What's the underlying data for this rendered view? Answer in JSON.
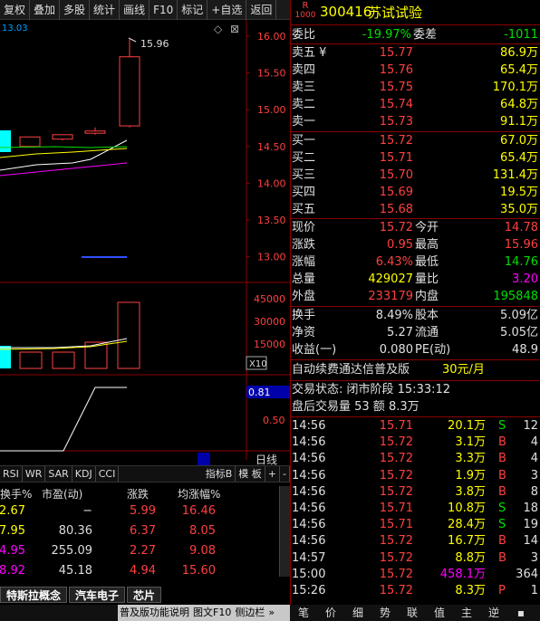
{
  "toolbar": {
    "items": [
      "复权",
      "叠加",
      "多股",
      "统计",
      "画线",
      "F10",
      "标记",
      "+自选",
      "返回"
    ]
  },
  "chart": {
    "top_left_value": "13.03",
    "price_ticks": [
      "16.00",
      "15.50",
      "15.00",
      "14.50",
      "14.00",
      "13.50",
      "13.00"
    ],
    "peak_label": "15.96",
    "volume_ticks": [
      "45000",
      "30000",
      "15000"
    ],
    "volume_unit": "X10",
    "indicator_ticks": [
      "0.50"
    ],
    "indicator_value": "0.81",
    "period": "日线"
  },
  "indicator_tabs": [
    "RSI",
    "WR",
    "SAR",
    "KDJ",
    "CCI"
  ],
  "indicator_menu": [
    "指标B",
    "模 板",
    "+",
    "-"
  ],
  "table": {
    "headers": [
      "换手%",
      "市盈(动)",
      "涨跌",
      "均涨幅%"
    ],
    "rows": [
      [
        "2.67",
        "−",
        "5.99",
        "16.46"
      ],
      [
        "7.95",
        "80.36",
        "6.37",
        "8.05"
      ],
      [
        "4.95",
        "255.09",
        "2.27",
        "9.08"
      ],
      [
        "8.92",
        "45.18",
        "4.94",
        "15.60"
      ]
    ]
  },
  "bottom_tabs": [
    "特斯拉概念",
    "汽车电子",
    "芯片"
  ],
  "status": {
    "items": [
      "普及版功能说明",
      "图文F10",
      "侧边栏",
      "»"
    ]
  },
  "quote": {
    "code": "300416",
    "name": "苏试试验",
    "tag_top": "R",
    "tag_bottom": "1000",
    "weibi_label": "委比",
    "weibi": "-19.97%",
    "weicha_label": "委差",
    "weicha": "-1011",
    "sells": [
      {
        "label": "卖五",
        "price": "15.77",
        "vol": "86.9万",
        "extra": "¥"
      },
      {
        "label": "卖四",
        "price": "15.76",
        "vol": "65.4万"
      },
      {
        "label": "卖三",
        "price": "15.75",
        "vol": "170.1万"
      },
      {
        "label": "卖二",
        "price": "15.74",
        "vol": "64.8万"
      },
      {
        "label": "卖一",
        "price": "15.73",
        "vol": "91.1万"
      }
    ],
    "buys": [
      {
        "label": "买一",
        "price": "15.72",
        "vol": "67.0万"
      },
      {
        "label": "买二",
        "price": "15.71",
        "vol": "65.4万"
      },
      {
        "label": "买三",
        "price": "15.70",
        "vol": "131.4万"
      },
      {
        "label": "买四",
        "price": "15.69",
        "vol": "19.5万"
      },
      {
        "label": "买五",
        "price": "15.68",
        "vol": "35.0万"
      }
    ],
    "stats": [
      {
        "l1": "现价",
        "v1": "15.72",
        "l2": "今开",
        "v2": "14.78",
        "c1": "r",
        "c2": "r"
      },
      {
        "l1": "涨跌",
        "v1": "0.95",
        "l2": "最高",
        "v2": "15.96",
        "c1": "r",
        "c2": "r"
      },
      {
        "l1": "涨幅",
        "v1": "6.43%",
        "l2": "最低",
        "v2": "14.76",
        "c1": "r",
        "c2": "g"
      },
      {
        "l1": "总量",
        "v1": "429027",
        "l2": "量比",
        "v2": "3.20",
        "c1": "y",
        "c2": "m"
      },
      {
        "l1": "外盘",
        "v1": "233179",
        "l2": "内盘",
        "v2": "195848",
        "c1": "r",
        "c2": "g"
      }
    ],
    "stats2": [
      {
        "l1": "换手",
        "v1": "8.49%",
        "l2": "股本",
        "v2": "5.09亿"
      },
      {
        "l1": "净资",
        "v1": "5.27",
        "l2": "流通",
        "v2": "5.05亿"
      },
      {
        "l1": "收益(一)",
        "v1": "0.080",
        "l2": "PE(动)",
        "v2": "48.9"
      }
    ],
    "promo": "自动续费通达信普及版",
    "promo_price": "30元/月",
    "trade_status": "交易状态: 闭市阶段 15:33:12",
    "after_hours": "盘后交易量 53 额 8.3万"
  },
  "ticks": [
    [
      "14:56",
      "15.71",
      "20.1万",
      "S",
      "12"
    ],
    [
      "14:56",
      "15.72",
      "3.1万",
      "B",
      "4"
    ],
    [
      "14:56",
      "15.72",
      "3.3万",
      "B",
      "4"
    ],
    [
      "14:56",
      "15.72",
      "1.9万",
      "B",
      "3"
    ],
    [
      "14:56",
      "15.72",
      "3.8万",
      "B",
      "8"
    ],
    [
      "14:56",
      "15.71",
      "10.8万",
      "S",
      "18"
    ],
    [
      "14:56",
      "15.71",
      "28.4万",
      "S",
      "19"
    ],
    [
      "14:56",
      "15.72",
      "16.7万",
      "B",
      "14"
    ],
    [
      "14:57",
      "15.72",
      "8.8万",
      "B",
      "3"
    ],
    [
      "15:00",
      "15.72",
      "458.1万",
      "",
      "364"
    ],
    [
      "15:26",
      "15.72",
      "8.3万",
      "P",
      "1"
    ]
  ],
  "right_bottom_tabs": [
    "笔",
    "价",
    "细",
    "势",
    "联",
    "值",
    "主",
    "逆",
    "▪"
  ]
}
